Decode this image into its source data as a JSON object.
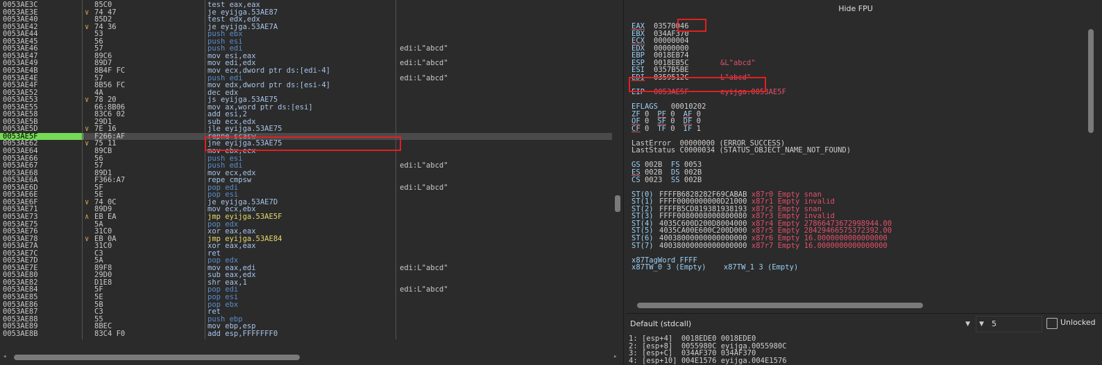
{
  "disasm": {
    "current_address": "0053AE5F",
    "rows": [
      {
        "addr": "0053AE3C",
        "arrow": "",
        "bytes": "85C0",
        "instr": "test eax,eax",
        "kind": "default",
        "comment": ""
      },
      {
        "addr": "0053AE3E",
        "arrow": "v",
        "bytes": "74 47",
        "instr": "je eyijga.53AE87",
        "kind": "jcc",
        "comment": ""
      },
      {
        "addr": "0053AE40",
        "arrow": "",
        "bytes": "85D2",
        "instr": "test edx,edx",
        "kind": "default",
        "comment": ""
      },
      {
        "addr": "0053AE42",
        "arrow": "v",
        "bytes": "74 36",
        "instr": "je eyijga.53AE7A",
        "kind": "jcc",
        "comment": ""
      },
      {
        "addr": "0053AE44",
        "arrow": "",
        "bytes": "53",
        "instr": "push ebx",
        "kind": "push",
        "comment": ""
      },
      {
        "addr": "0053AE45",
        "arrow": "",
        "bytes": "56",
        "instr": "push esi",
        "kind": "push",
        "comment": ""
      },
      {
        "addr": "0053AE46",
        "arrow": "",
        "bytes": "57",
        "instr": "push edi",
        "kind": "push",
        "comment": "edi:L\"abcd\""
      },
      {
        "addr": "0053AE47",
        "arrow": "",
        "bytes": "89C6",
        "instr": "mov esi,eax",
        "kind": "default",
        "comment": ""
      },
      {
        "addr": "0053AE49",
        "arrow": "",
        "bytes": "89D7",
        "instr": "mov edi,edx",
        "kind": "default",
        "comment": "edi:L\"abcd\""
      },
      {
        "addr": "0053AE4B",
        "arrow": "",
        "bytes": "8B4F FC",
        "instr": "mov ecx,dword ptr ds:[edi-4]",
        "kind": "default",
        "comment": ""
      },
      {
        "addr": "0053AE4E",
        "arrow": "",
        "bytes": "57",
        "instr": "push edi",
        "kind": "push",
        "comment": "edi:L\"abcd\""
      },
      {
        "addr": "0053AE4F",
        "arrow": "",
        "bytes": "8B56 FC",
        "instr": "mov edx,dword ptr ds:[esi-4]",
        "kind": "default",
        "comment": ""
      },
      {
        "addr": "0053AE52",
        "arrow": "",
        "bytes": "4A",
        "instr": "dec edx",
        "kind": "default",
        "comment": ""
      },
      {
        "addr": "0053AE53",
        "arrow": "v",
        "bytes": "78 20",
        "instr": "js eyijga.53AE75",
        "kind": "jcc",
        "comment": ""
      },
      {
        "addr": "0053AE55",
        "arrow": "",
        "bytes": "66:8B06",
        "instr": "mov ax,word ptr ds:[esi]",
        "kind": "default",
        "comment": ""
      },
      {
        "addr": "0053AE58",
        "arrow": "",
        "bytes": "83C6 02",
        "instr": "add esi,2",
        "kind": "default",
        "comment": ""
      },
      {
        "addr": "0053AE5B",
        "arrow": "",
        "bytes": "29D1",
        "instr": "sub ecx,edx",
        "kind": "default",
        "comment": ""
      },
      {
        "addr": "0053AE5D",
        "arrow": "v",
        "bytes": "7E 16",
        "instr": "jle eyijga.53AE75",
        "kind": "jcc",
        "comment": ""
      },
      {
        "addr": "0053AE5F",
        "arrow": "",
        "bytes": "F266:AF",
        "instr": "repne scasw",
        "kind": "default",
        "comment": ""
      },
      {
        "addr": "0053AE62",
        "arrow": "v",
        "bytes": "75 11",
        "instr": "jne eyijga.53AE75",
        "kind": "jcc",
        "comment": ""
      },
      {
        "addr": "0053AE64",
        "arrow": "",
        "bytes": "89CB",
        "instr": "mov ebx,ecx",
        "kind": "default",
        "comment": ""
      },
      {
        "addr": "0053AE66",
        "arrow": "",
        "bytes": "56",
        "instr": "push esi",
        "kind": "push",
        "comment": ""
      },
      {
        "addr": "0053AE67",
        "arrow": "",
        "bytes": "57",
        "instr": "push edi",
        "kind": "push",
        "comment": "edi:L\"abcd\""
      },
      {
        "addr": "0053AE68",
        "arrow": "",
        "bytes": "89D1",
        "instr": "mov ecx,edx",
        "kind": "default",
        "comment": ""
      },
      {
        "addr": "0053AE6A",
        "arrow": "",
        "bytes": "F366:A7",
        "instr": "repe cmpsw",
        "kind": "default",
        "comment": ""
      },
      {
        "addr": "0053AE6D",
        "arrow": "",
        "bytes": "5F",
        "instr": "pop edi",
        "kind": "pop",
        "comment": "edi:L\"abcd\""
      },
      {
        "addr": "0053AE6E",
        "arrow": "",
        "bytes": "5E",
        "instr": "pop esi",
        "kind": "pop",
        "comment": ""
      },
      {
        "addr": "0053AE6F",
        "arrow": "v",
        "bytes": "74 0C",
        "instr": "je eyijga.53AE7D",
        "kind": "jcc",
        "comment": ""
      },
      {
        "addr": "0053AE71",
        "arrow": "",
        "bytes": "89D9",
        "instr": "mov ecx,ebx",
        "kind": "default",
        "comment": ""
      },
      {
        "addr": "0053AE73",
        "arrow": "^",
        "bytes": "EB EA",
        "instr": "jmp eyijga.53AE5F",
        "kind": "jmp",
        "comment": ""
      },
      {
        "addr": "0053AE75",
        "arrow": "",
        "bytes": "5A",
        "instr": "pop edx",
        "kind": "pop",
        "comment": ""
      },
      {
        "addr": "0053AE76",
        "arrow": "",
        "bytes": "31C0",
        "instr": "xor eax,eax",
        "kind": "default",
        "comment": ""
      },
      {
        "addr": "0053AE78",
        "arrow": "v",
        "bytes": "EB 0A",
        "instr": "jmp eyijga.53AE84",
        "kind": "jmp",
        "comment": ""
      },
      {
        "addr": "0053AE7A",
        "arrow": "",
        "bytes": "31C0",
        "instr": "xor eax,eax",
        "kind": "default",
        "comment": ""
      },
      {
        "addr": "0053AE7C",
        "arrow": "",
        "bytes": "C3",
        "instr": "ret",
        "kind": "ret",
        "comment": ""
      },
      {
        "addr": "0053AE7D",
        "arrow": "",
        "bytes": "5A",
        "instr": "pop edx",
        "kind": "pop",
        "comment": ""
      },
      {
        "addr": "0053AE7E",
        "arrow": "",
        "bytes": "89F8",
        "instr": "mov eax,edi",
        "kind": "default",
        "comment": "edi:L\"abcd\""
      },
      {
        "addr": "0053AE80",
        "arrow": "",
        "bytes": "29D0",
        "instr": "sub eax,edx",
        "kind": "default",
        "comment": ""
      },
      {
        "addr": "0053AE82",
        "arrow": "",
        "bytes": "D1E8",
        "instr": "shr eax,1",
        "kind": "default",
        "comment": ""
      },
      {
        "addr": "0053AE84",
        "arrow": "",
        "bytes": "5F",
        "instr": "pop edi",
        "kind": "pop",
        "comment": "edi:L\"abcd\""
      },
      {
        "addr": "0053AE85",
        "arrow": "",
        "bytes": "5E",
        "instr": "pop esi",
        "kind": "pop",
        "comment": ""
      },
      {
        "addr": "0053AE86",
        "arrow": "",
        "bytes": "5B",
        "instr": "pop ebx",
        "kind": "pop",
        "comment": ""
      },
      {
        "addr": "0053AE87",
        "arrow": "",
        "bytes": "C3",
        "instr": "ret",
        "kind": "ret",
        "comment": ""
      },
      {
        "addr": "0053AE88",
        "arrow": "",
        "bytes": "55",
        "instr": "push ebp",
        "kind": "push",
        "comment": ""
      },
      {
        "addr": "0053AE89",
        "arrow": "",
        "bytes": "8BEC",
        "instr": "mov ebp,esp",
        "kind": "default",
        "comment": ""
      },
      {
        "addr": "0053AE8B",
        "arrow": "",
        "bytes": "83C4 F0",
        "instr": "add esp,FFFFFFF0",
        "kind": "default",
        "comment": ""
      }
    ]
  },
  "registers": {
    "header": "Hide FPU",
    "gpr": [
      {
        "name": "EAX",
        "value": "03570046",
        "note": "",
        "underline": true
      },
      {
        "name": "EBX",
        "value": "034AF370",
        "note": "",
        "underline": false
      },
      {
        "name": "ECX",
        "value": "00000004",
        "note": "",
        "underline": true
      },
      {
        "name": "EDX",
        "value": "00000000",
        "note": "",
        "underline": false
      },
      {
        "name": "EBP",
        "value": "0018EB74",
        "note": "",
        "underline": false
      },
      {
        "name": "ESP",
        "value": "0018EB5C",
        "note": "&L\"abcd\"",
        "underline": false
      },
      {
        "name": "ESI",
        "value": "0357B5BE",
        "note": "",
        "underline": false
      },
      {
        "name": "EDI",
        "value": "0359512C",
        "note": "L\"abcd\"",
        "underline": true
      }
    ],
    "eip": {
      "name": "EIP",
      "value": "0053AE5F",
      "note": "eyijga.0053AE5F"
    },
    "eflags": {
      "name": "EFLAGS",
      "value": "00010202"
    },
    "flag_rows": [
      [
        {
          "name": "ZF",
          "value": "0",
          "ul": false
        },
        {
          "name": "PF",
          "value": "0",
          "ul": true
        },
        {
          "name": "AF",
          "value": "0",
          "ul": true
        }
      ],
      [
        {
          "name": "OF",
          "value": "0",
          "ul": true
        },
        {
          "name": "SF",
          "value": "0",
          "ul": true
        },
        {
          "name": "DF",
          "value": "0",
          "ul": true
        }
      ],
      [
        {
          "name": "CF",
          "value": "0",
          "ul": true
        },
        {
          "name": "TF",
          "value": "0",
          "ul": false
        },
        {
          "name": "IF",
          "value": "1",
          "ul": false
        }
      ]
    ],
    "last_error": "LastError  00000000 (ERROR_SUCCESS)",
    "last_status": "LastStatus C0000034 (STATUS_OBJECT_NAME_NOT_FOUND)",
    "segments": [
      "GS 002B  FS 0053",
      "ES 002B  DS 002B",
      "CS 0023  SS 002B"
    ],
    "fpu": [
      {
        "name": "ST(0)",
        "value": "FFFFB6828282F69CABAB",
        "note": "x87r0 Empty snan"
      },
      {
        "name": "ST(1)",
        "value": "FFFF0000000000D21000",
        "note": "x87r1 Empty invalid"
      },
      {
        "name": "ST(2)",
        "value": "FFFFB5CD819381938193",
        "note": "x87r2 Empty snan"
      },
      {
        "name": "ST(3)",
        "value": "FFFF0080008000800080",
        "note": "x87r3 Empty invalid"
      },
      {
        "name": "ST(4)",
        "value": "4035C600D200D8004000",
        "note": "x87r4 Empty 27866473672998944.00"
      },
      {
        "name": "ST(5)",
        "value": "4035CA00E600C200D000",
        "note": "x87r5 Empty 28429466575372392.00"
      },
      {
        "name": "ST(6)",
        "value": "40038000000000000000",
        "note": "x87r6 Empty 16.0000000000000000"
      },
      {
        "name": "ST(7)",
        "value": "40038000000000000000",
        "note": "x87r7 Empty 16.0000000000000000"
      }
    ],
    "tagword": "x87TagWord FFFF",
    "tw_line": "x87TW_0 3 (Empty)    x87TW_1 3 (Empty)"
  },
  "callbar": {
    "convention": "Default (stdcall)",
    "arg_count": "5",
    "unlock_label": "Unlocked"
  },
  "args": [
    "1: [esp+4]  0018EDE0 0018EDE0",
    "2: [esp+8]  0055980C eyijga.0055980C",
    "3: [esp+C]  034AF370 034AF370",
    "4: [esp+10] 004E1576 eyijga.004E1576"
  ]
}
